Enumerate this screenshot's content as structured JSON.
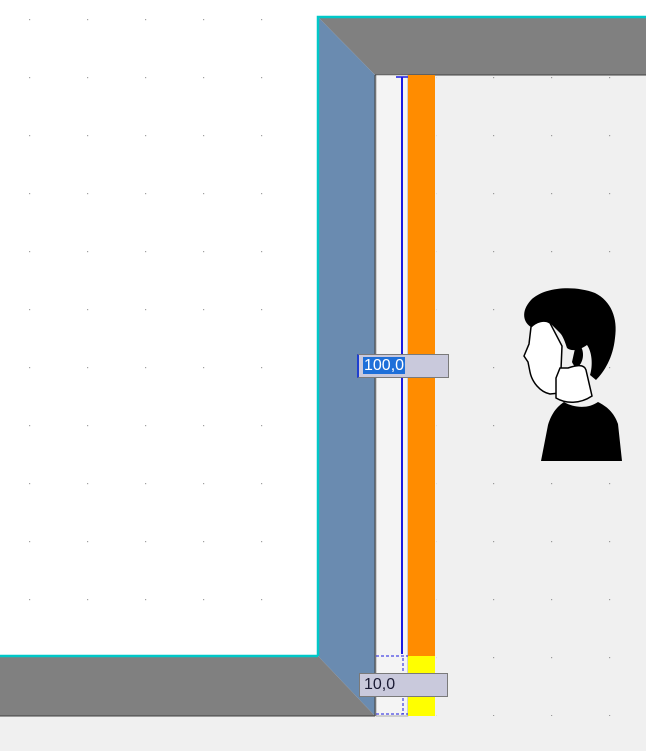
{
  "dimensions": {
    "wall_height": "100,0",
    "bottom_offset": "10,0"
  },
  "colors": {
    "room_floor": "#f0f0f0",
    "wall_fill": "#808080",
    "wall_side_fill": "#6a8bb0",
    "wall_outline": "#00c8c8",
    "layer_orange": "#ff8c00",
    "layer_yellow": "#ffff00",
    "dimension_line": "#1a1ae0",
    "grid_dot": "#a0a0a0"
  },
  "icons": {
    "person": "person-silhouette-icon"
  }
}
